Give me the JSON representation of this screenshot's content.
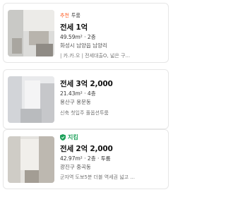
{
  "listings": [
    {
      "tag_recommend": "추천",
      "room_type": "투룸",
      "price": "전세 1억",
      "meta": "49.59m² · 2층",
      "address": "화성시 남양읍 남양리",
      "description": "| 카.카.오 |   전세대출O, 넓은 구..."
    },
    {
      "price": "전세 3억 2,000",
      "meta": "21.43m² · 4층",
      "address": "용산구 용문동",
      "description": "신축 첫입주 풀옵션투룸"
    },
    {
      "verified_label": "지킴",
      "price": "전세 2억 2,000",
      "meta": "42.97m² · 2층 · 투룸",
      "address": "광진구 중곡동",
      "description": "군자역 도보5분 더블 역세권 넓고 ..."
    }
  ],
  "colors": {
    "recommend": "#ff5a1f",
    "verified": "#1da15a"
  }
}
